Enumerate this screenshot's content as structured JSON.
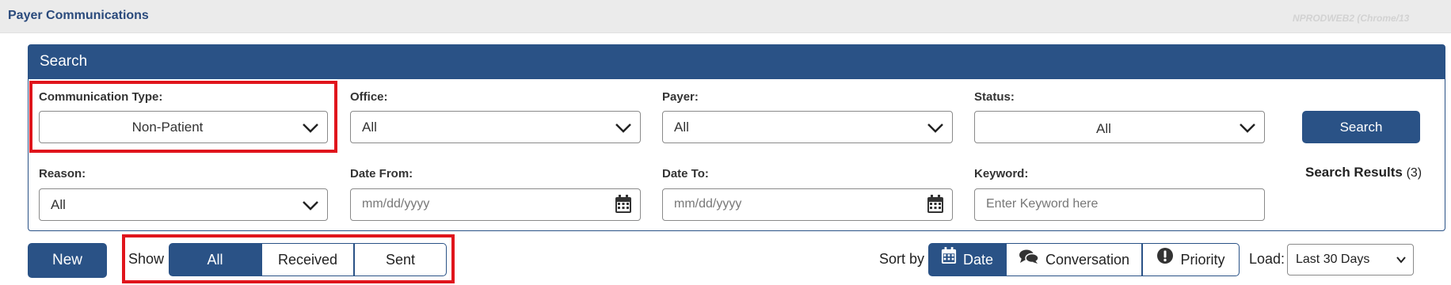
{
  "header": {
    "title": "Payer Communications",
    "env_label": "NPRODWEB2 (Chrome/13"
  },
  "search_panel": {
    "title": "Search",
    "communication_type": {
      "label": "Communication Type:",
      "value": "Non-Patient"
    },
    "office": {
      "label": "Office:",
      "value": "All"
    },
    "payer": {
      "label": "Payer:",
      "value": "All"
    },
    "status": {
      "label": "Status:",
      "value": "All"
    },
    "reason": {
      "label": "Reason:",
      "value": "All"
    },
    "date_from": {
      "label": "Date From:",
      "placeholder": "mm/dd/yyyy"
    },
    "date_to": {
      "label": "Date To:",
      "placeholder": "mm/dd/yyyy"
    },
    "keyword": {
      "label": "Keyword:",
      "placeholder": "Enter Keyword here"
    },
    "search_button": "Search",
    "results_label": "Search Results",
    "results_count": "(3)"
  },
  "toolbar": {
    "new_button": "New",
    "show_label": "Show",
    "show_options": [
      "All",
      "Received",
      "Sent"
    ],
    "show_selected": "All",
    "sort_label": "Sort by",
    "sort_options": [
      {
        "label": "Date",
        "icon": "calendar-icon",
        "active": true
      },
      {
        "label": "Conversation",
        "icon": "comments-icon",
        "active": false
      },
      {
        "label": "Priority",
        "icon": "exclamation-circle-icon",
        "active": false
      }
    ],
    "load_label": "Load:",
    "load_value": "Last 30 Days"
  },
  "colors": {
    "primary": "#2a5286",
    "highlight": "#e0151c",
    "title": "#2a4a7c"
  }
}
